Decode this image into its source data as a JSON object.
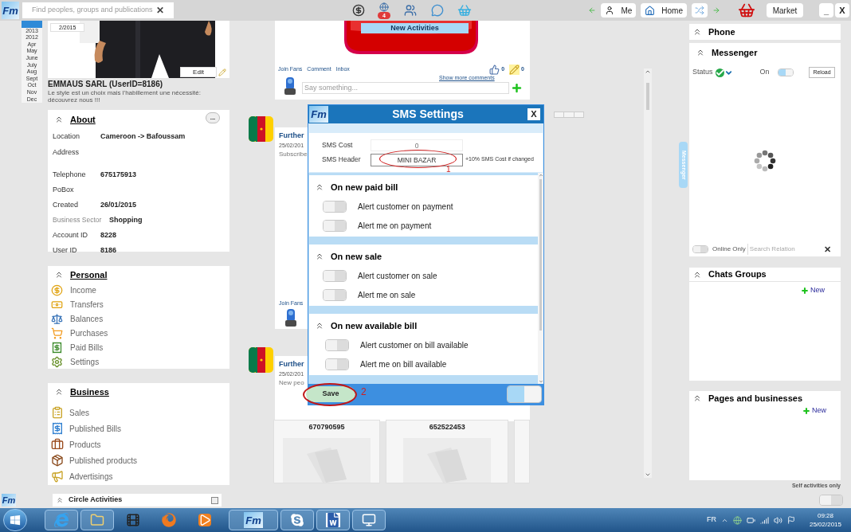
{
  "top_bar": {
    "logo": "Fm",
    "search": {
      "placeholder": "Find peoples, groups and publications"
    },
    "clear": "✕",
    "notification_badge": "4",
    "nav_buttons": [
      "Me",
      "Home"
    ],
    "market_button": "Market",
    "window_buttons": [
      "_",
      "X"
    ]
  },
  "timeline": [
    {
      "selected": true
    },
    {
      "label": "2013",
      "selected": false
    },
    {
      "label": "2012",
      "selected": false
    },
    {
      "label": "Apr",
      "selected": false
    },
    {
      "label": "May",
      "selected": false
    },
    {
      "label": "June",
      "selected": false
    },
    {
      "label": "July",
      "selected": false
    },
    {
      "label": "Aug",
      "selected": false
    },
    {
      "label": "Sept",
      "selected": false
    },
    {
      "label": "Oct",
      "selected": false
    },
    {
      "label": "Nov",
      "selected": false
    },
    {
      "label": "Dec",
      "selected": false
    }
  ],
  "profile": {
    "cover_date": "2/2015",
    "edit_button": "Edit",
    "name": "EMMAUS SARL (UserID=8186)",
    "tagline": "Le style est un choix mais l'habillement une nécessité: découvrez nous !!!"
  },
  "about": {
    "title": "About",
    "more_button": "...",
    "fields": [
      {
        "label": "Location",
        "value": "Cameroon -> Bafoussam",
        "muted": false
      },
      {
        "label": "Address",
        "muted": false
      },
      {
        "label": "Telephone",
        "value": "675175913",
        "muted": false
      },
      {
        "label": "PoBox",
        "muted": false
      },
      {
        "label": "Created",
        "value": "26/01/2015",
        "muted": false
      },
      {
        "label": "Business Sector",
        "value": "Shopping",
        "muted": true
      },
      {
        "label": "Account ID",
        "value": "8228",
        "muted": false
      },
      {
        "label": "User ID",
        "value": "8186",
        "muted": false
      }
    ]
  },
  "personal": {
    "title": "Personal",
    "items": [
      "Income",
      "Transfers",
      "Balances",
      "Purchases",
      "Paid Bills",
      "Settings"
    ]
  },
  "business": {
    "title": "Business",
    "items": [
      "Sales",
      "Published Bills",
      "Products",
      "Published products",
      "Advertisings"
    ]
  },
  "feed": {
    "top_post": {
      "tab": "New Activities",
      "actions": [
        "Join Fans",
        "Comment",
        "Inbox"
      ],
      "likes": "0",
      "comments": "0",
      "show_more": "Show more comments",
      "comment_placeholder": "Say something..."
    },
    "posts": [
      {
        "author": "Further",
        "date": "25/02/201",
        "text": "Subscribe",
        "actions": [
          "Join Fans"
        ]
      },
      {
        "author": "Further",
        "date": "25/02/201",
        "text": "New peo"
      }
    ],
    "phone_cards": [
      "670790595",
      "652522453"
    ]
  },
  "dialog": {
    "logo": "Fm",
    "title": "SMS Settings",
    "close": "X",
    "sms_cost": {
      "label": "SMS Cost",
      "value": "0"
    },
    "sms_header": {
      "label": "SMS Header",
      "value": "MINI BAZAR",
      "note": "+10% SMS Cost if changed"
    },
    "sections": [
      {
        "title": "On new paid bill",
        "options": [
          {
            "label": "Alert customer on payment",
            "on": false
          },
          {
            "label": "Alert me on payment",
            "on": false
          }
        ]
      },
      {
        "title": "On new sale",
        "options": [
          {
            "label": "Alert customer on sale",
            "on": false
          },
          {
            "label": "Alert me on sale",
            "on": false
          }
        ]
      },
      {
        "title": "On new available bill",
        "options": [
          {
            "label": "Alert customer on bill available",
            "on": false
          },
          {
            "label": "Alert me on bill available",
            "on": false
          }
        ]
      }
    ],
    "save_button": "Save",
    "footer_toggle_on": true,
    "annotations": [
      "1",
      "2"
    ]
  },
  "right_panel": {
    "phone": {
      "title": "Phone"
    },
    "messenger": {
      "title": "Messenger",
      "side_tab": "Messenger",
      "status_label": "Status",
      "on_label": "On",
      "toggle_on": true,
      "reload": "Reload",
      "online_only": "Online Only",
      "online_only_on": false,
      "search_placeholder": "Search Relation",
      "clear": "✕"
    },
    "chats_groups": {
      "title": "Chats Groups",
      "new": "New"
    },
    "pages": {
      "title": "Pages and businesses",
      "new": "New"
    },
    "self_activities": "Self activities only",
    "self_toggle_on": false
  },
  "bottom_bar": {
    "logo": "Fm",
    "circle_activities": {
      "title": "Circle Activities",
      "checked": false
    }
  },
  "taskbar": {
    "logo": "Fm",
    "language": "FR",
    "time": "09:28",
    "date": "25/02/2015"
  }
}
